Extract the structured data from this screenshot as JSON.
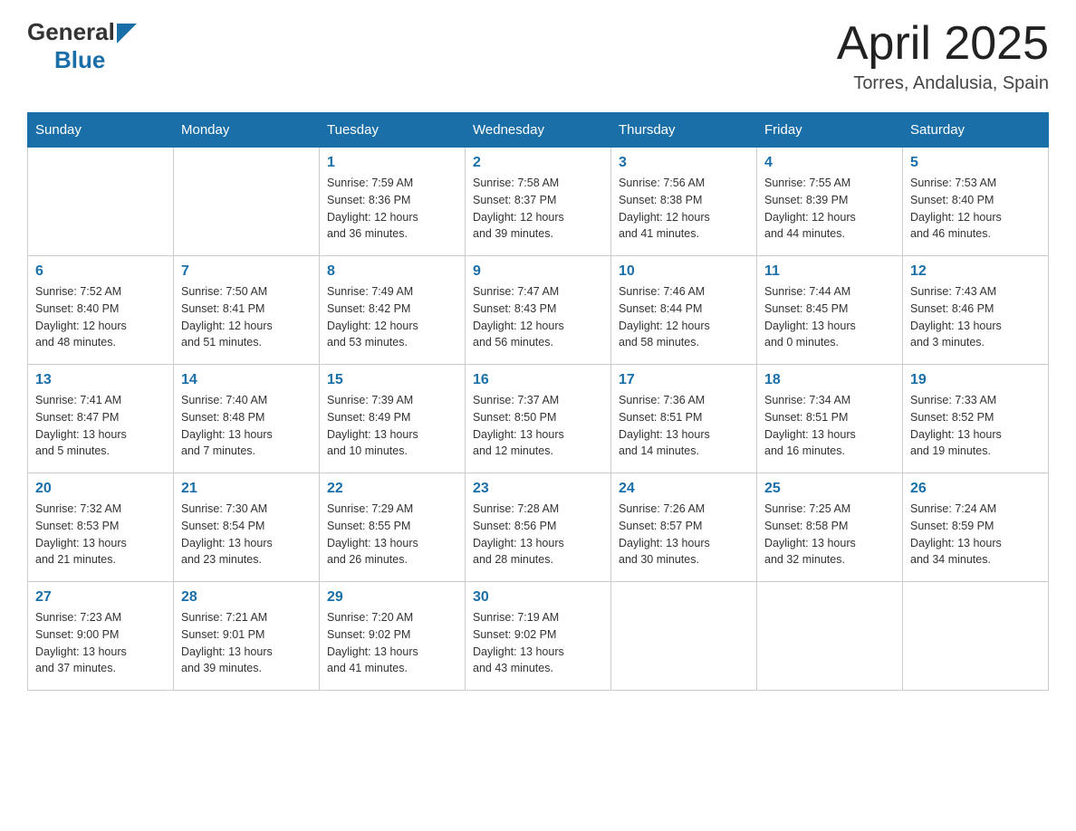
{
  "header": {
    "logo_general": "General",
    "logo_blue": "Blue",
    "month_title": "April 2025",
    "location": "Torres, Andalusia, Spain"
  },
  "days_of_week": [
    "Sunday",
    "Monday",
    "Tuesday",
    "Wednesday",
    "Thursday",
    "Friday",
    "Saturday"
  ],
  "weeks": [
    [
      {
        "day": "",
        "info": ""
      },
      {
        "day": "",
        "info": ""
      },
      {
        "day": "1",
        "info": "Sunrise: 7:59 AM\nSunset: 8:36 PM\nDaylight: 12 hours\nand 36 minutes."
      },
      {
        "day": "2",
        "info": "Sunrise: 7:58 AM\nSunset: 8:37 PM\nDaylight: 12 hours\nand 39 minutes."
      },
      {
        "day": "3",
        "info": "Sunrise: 7:56 AM\nSunset: 8:38 PM\nDaylight: 12 hours\nand 41 minutes."
      },
      {
        "day": "4",
        "info": "Sunrise: 7:55 AM\nSunset: 8:39 PM\nDaylight: 12 hours\nand 44 minutes."
      },
      {
        "day": "5",
        "info": "Sunrise: 7:53 AM\nSunset: 8:40 PM\nDaylight: 12 hours\nand 46 minutes."
      }
    ],
    [
      {
        "day": "6",
        "info": "Sunrise: 7:52 AM\nSunset: 8:40 PM\nDaylight: 12 hours\nand 48 minutes."
      },
      {
        "day": "7",
        "info": "Sunrise: 7:50 AM\nSunset: 8:41 PM\nDaylight: 12 hours\nand 51 minutes."
      },
      {
        "day": "8",
        "info": "Sunrise: 7:49 AM\nSunset: 8:42 PM\nDaylight: 12 hours\nand 53 minutes."
      },
      {
        "day": "9",
        "info": "Sunrise: 7:47 AM\nSunset: 8:43 PM\nDaylight: 12 hours\nand 56 minutes."
      },
      {
        "day": "10",
        "info": "Sunrise: 7:46 AM\nSunset: 8:44 PM\nDaylight: 12 hours\nand 58 minutes."
      },
      {
        "day": "11",
        "info": "Sunrise: 7:44 AM\nSunset: 8:45 PM\nDaylight: 13 hours\nand 0 minutes."
      },
      {
        "day": "12",
        "info": "Sunrise: 7:43 AM\nSunset: 8:46 PM\nDaylight: 13 hours\nand 3 minutes."
      }
    ],
    [
      {
        "day": "13",
        "info": "Sunrise: 7:41 AM\nSunset: 8:47 PM\nDaylight: 13 hours\nand 5 minutes."
      },
      {
        "day": "14",
        "info": "Sunrise: 7:40 AM\nSunset: 8:48 PM\nDaylight: 13 hours\nand 7 minutes."
      },
      {
        "day": "15",
        "info": "Sunrise: 7:39 AM\nSunset: 8:49 PM\nDaylight: 13 hours\nand 10 minutes."
      },
      {
        "day": "16",
        "info": "Sunrise: 7:37 AM\nSunset: 8:50 PM\nDaylight: 13 hours\nand 12 minutes."
      },
      {
        "day": "17",
        "info": "Sunrise: 7:36 AM\nSunset: 8:51 PM\nDaylight: 13 hours\nand 14 minutes."
      },
      {
        "day": "18",
        "info": "Sunrise: 7:34 AM\nSunset: 8:51 PM\nDaylight: 13 hours\nand 16 minutes."
      },
      {
        "day": "19",
        "info": "Sunrise: 7:33 AM\nSunset: 8:52 PM\nDaylight: 13 hours\nand 19 minutes."
      }
    ],
    [
      {
        "day": "20",
        "info": "Sunrise: 7:32 AM\nSunset: 8:53 PM\nDaylight: 13 hours\nand 21 minutes."
      },
      {
        "day": "21",
        "info": "Sunrise: 7:30 AM\nSunset: 8:54 PM\nDaylight: 13 hours\nand 23 minutes."
      },
      {
        "day": "22",
        "info": "Sunrise: 7:29 AM\nSunset: 8:55 PM\nDaylight: 13 hours\nand 26 minutes."
      },
      {
        "day": "23",
        "info": "Sunrise: 7:28 AM\nSunset: 8:56 PM\nDaylight: 13 hours\nand 28 minutes."
      },
      {
        "day": "24",
        "info": "Sunrise: 7:26 AM\nSunset: 8:57 PM\nDaylight: 13 hours\nand 30 minutes."
      },
      {
        "day": "25",
        "info": "Sunrise: 7:25 AM\nSunset: 8:58 PM\nDaylight: 13 hours\nand 32 minutes."
      },
      {
        "day": "26",
        "info": "Sunrise: 7:24 AM\nSunset: 8:59 PM\nDaylight: 13 hours\nand 34 minutes."
      }
    ],
    [
      {
        "day": "27",
        "info": "Sunrise: 7:23 AM\nSunset: 9:00 PM\nDaylight: 13 hours\nand 37 minutes."
      },
      {
        "day": "28",
        "info": "Sunrise: 7:21 AM\nSunset: 9:01 PM\nDaylight: 13 hours\nand 39 minutes."
      },
      {
        "day": "29",
        "info": "Sunrise: 7:20 AM\nSunset: 9:02 PM\nDaylight: 13 hours\nand 41 minutes."
      },
      {
        "day": "30",
        "info": "Sunrise: 7:19 AM\nSunset: 9:02 PM\nDaylight: 13 hours\nand 43 minutes."
      },
      {
        "day": "",
        "info": ""
      },
      {
        "day": "",
        "info": ""
      },
      {
        "day": "",
        "info": ""
      }
    ]
  ]
}
